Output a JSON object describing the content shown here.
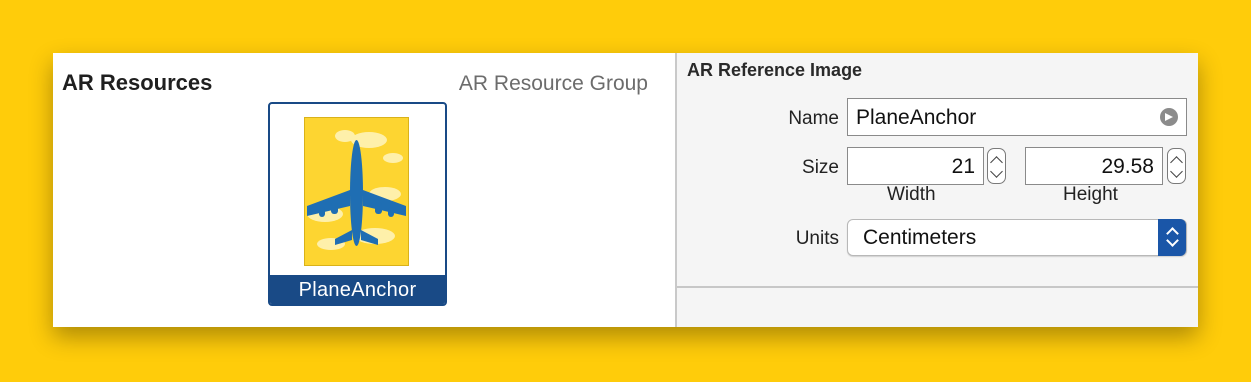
{
  "colors": {
    "background": "#ffcc0a",
    "selection": "#194a86",
    "select_accent": "#1a56a8",
    "art_yellow": "#fdd531",
    "plane_blue": "#1f6eb3"
  },
  "left": {
    "title": "AR Resources",
    "group_label": "AR Resource Group",
    "asset": {
      "name": "PlaneAnchor",
      "image_icon": "airplane-icon"
    }
  },
  "inspector": {
    "title": "AR Reference Image",
    "name_label": "Name",
    "name_value": "PlaneAnchor",
    "name_action_icon": "go-arrow-icon",
    "size_label": "Size",
    "width_value": "21",
    "height_value": "29.58",
    "width_label": "Width",
    "height_label": "Height",
    "units_label": "Units",
    "units_value": "Centimeters"
  }
}
